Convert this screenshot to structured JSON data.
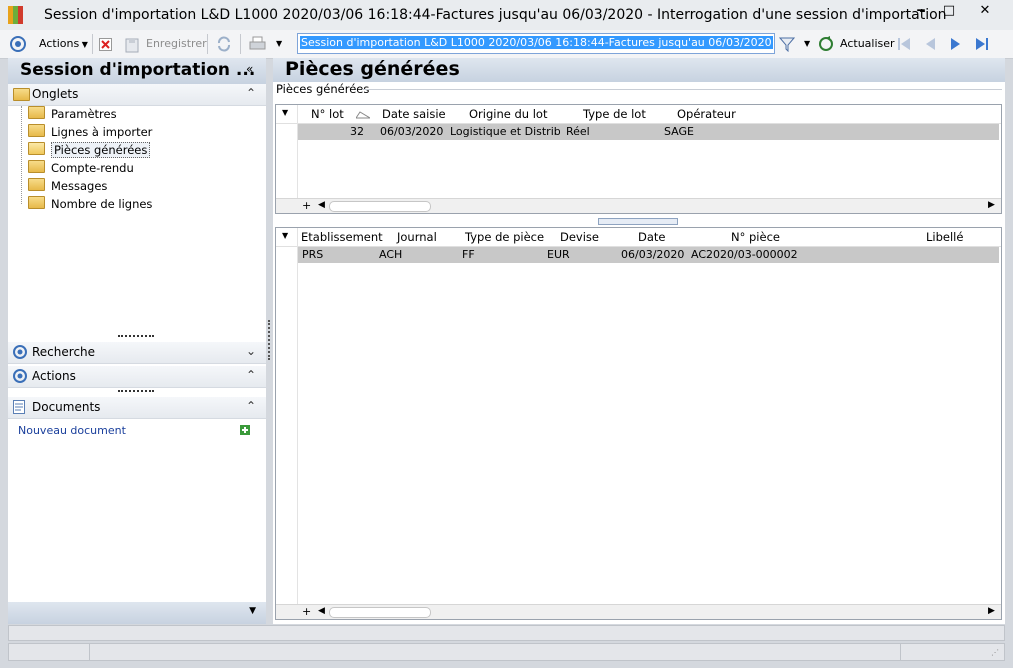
{
  "window": {
    "title": "Session d'importation L&D L1000 2020/03/06 16:18:44-Factures jusqu'au 06/03/2020 -  Interrogation d'une session d'importation",
    "buttons": [
      "‒",
      "□",
      "✕"
    ]
  },
  "toolbar": {
    "actions_label": "Actions",
    "save_label": "Enregistrer",
    "search_value": "Session d'importation L&D L1000 2020/03/06 16:18:44-Factures jusqu'au 06/03/2020",
    "refresh_label": "Actualiser"
  },
  "left": {
    "title": "Session d'importation ...",
    "onglets_label": "Onglets",
    "tabs": [
      "Paramètres",
      "Lignes à importer",
      "Pièces générées",
      "Compte-rendu",
      "Messages",
      "Nombre de lignes"
    ],
    "selected_tab": "Pièces générées",
    "recherche_label": "Recherche",
    "actions_label": "Actions",
    "documents_label": "Documents",
    "new_document_label": "Nouveau document"
  },
  "main": {
    "title": "Pièces générées",
    "group_label": "Pièces générées",
    "lots": {
      "columns": [
        "N° lot",
        "Date saisie",
        "Origine du lot",
        "Type de lot",
        "Opérateur"
      ],
      "rows": [
        [
          "32",
          "06/03/2020",
          "Logistique et Distribu",
          "Réel",
          "SAGE"
        ]
      ]
    },
    "pieces": {
      "columns": [
        "Etablissement",
        "Journal",
        "Type de pièce",
        "Devise",
        "Date",
        "N° pièce",
        "Libellé"
      ],
      "rows": [
        [
          "PRS",
          "ACH",
          "FF",
          "EUR",
          "06/03/2020",
          "AC2020/03-000002",
          ""
        ]
      ]
    }
  },
  "colors": {
    "selection": "#3399ff",
    "row_highlight": "#c8c8c8",
    "header_gradient": "#c7d2e0",
    "link": "#1a3f9c"
  }
}
